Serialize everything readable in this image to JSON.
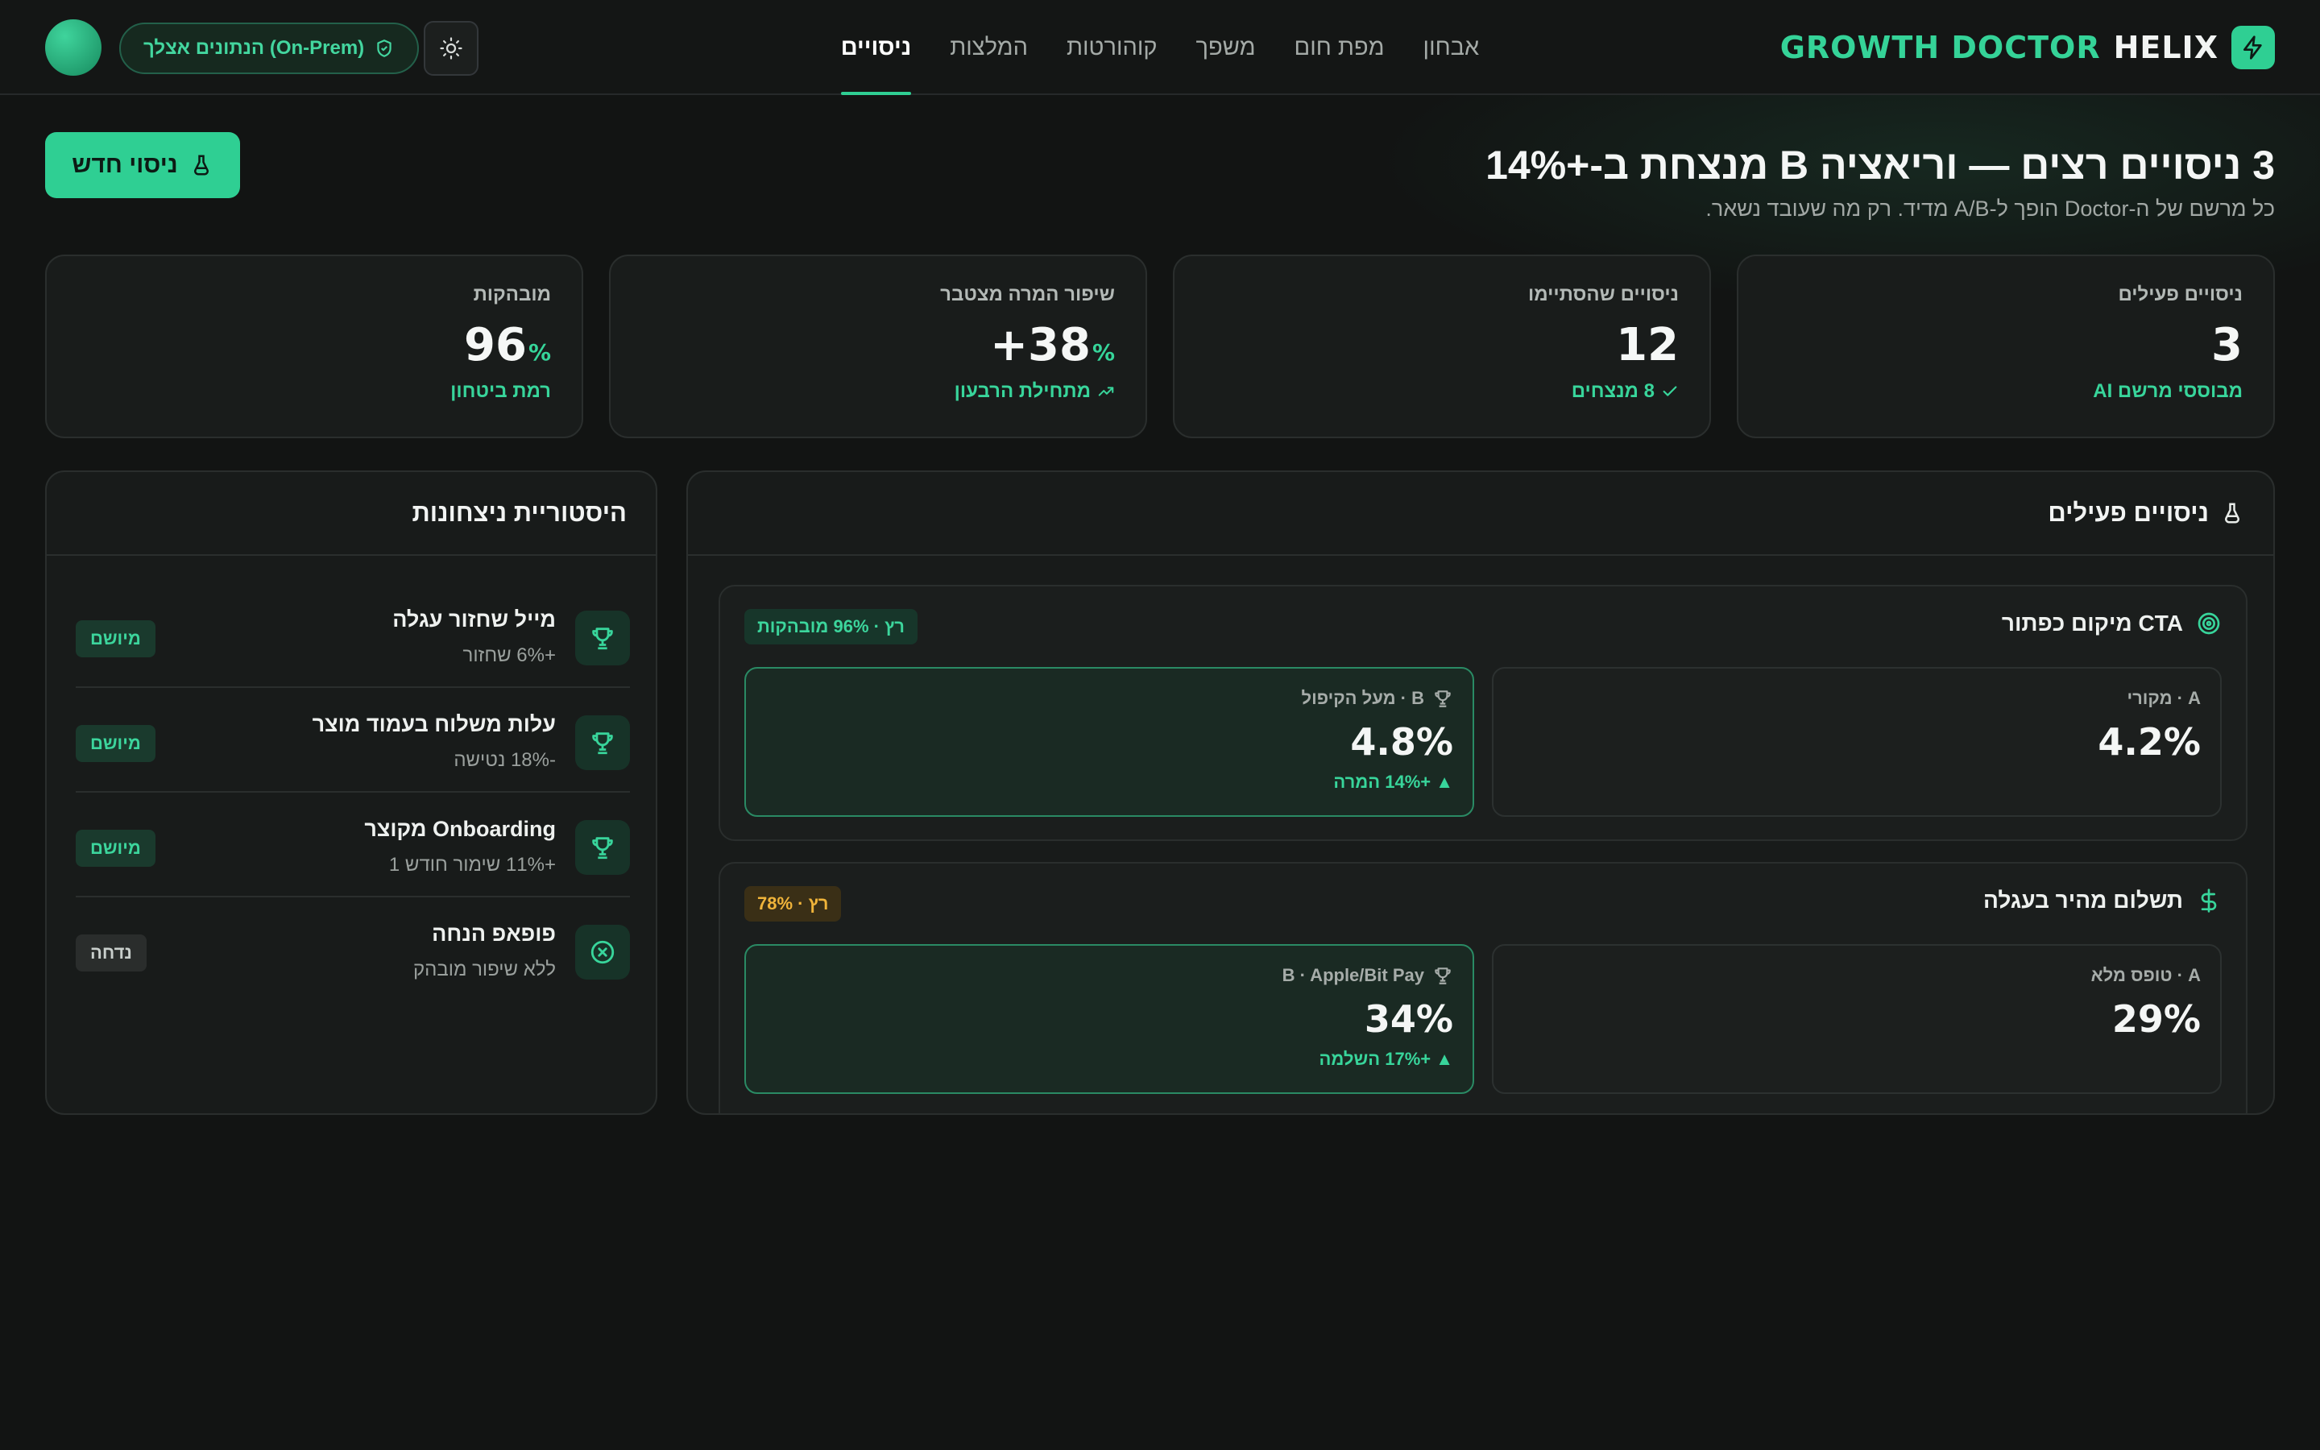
{
  "brand": {
    "name_primary": "HELIX",
    "name_secondary": "GROWTH DOCTOR",
    "icon": "lightning-icon",
    "accent": "#2fcf93"
  },
  "nav": {
    "items": [
      {
        "label": "אבחון",
        "active": false
      },
      {
        "label": "מפת חום",
        "active": false
      },
      {
        "label": "משפך",
        "active": false
      },
      {
        "label": "קוהורטות",
        "active": false
      },
      {
        "label": "המלצות",
        "active": false
      },
      {
        "label": "ניסויים",
        "active": true
      }
    ]
  },
  "header_controls": {
    "onprem_label": "הנתונים אצלך (On-Prem)",
    "onprem_icon": "shield-check-icon",
    "theme_icon": "sun-icon"
  },
  "page": {
    "title": "3 ניסויים רצים — וריאציה B מנצחת ב-+14%",
    "subtitle": "כל מרשם של ה-Doctor הופך ל-A/B מדיד. רק מה שעובד נשאר.",
    "new_button_label": "ניסוי חדש",
    "new_button_icon": "flask-icon"
  },
  "kpis": [
    {
      "label": "ניסויים פעילים",
      "value": "3",
      "unit": "",
      "foot": "מבוססי מרשם AI",
      "foot_icon": ""
    },
    {
      "label": "ניסויים שהסתיימו",
      "value": "12",
      "unit": "",
      "foot": "8 מנצחים",
      "foot_icon": "check-icon"
    },
    {
      "label": "שיפור המרה מצטבר",
      "value": "+38",
      "unit": "%",
      "foot": "מתחילת הרבעון",
      "foot_icon": "trending-up-icon"
    },
    {
      "label": "מובהקות",
      "value": "96",
      "unit": "%",
      "foot": "רמת ביטחון",
      "foot_icon": ""
    }
  ],
  "experiments_panel": {
    "title": "ניסויים פעילים",
    "icon": "flask-icon",
    "experiments": [
      {
        "title": "מיקום כפתור CTA",
        "icon": "target-icon",
        "status": "רץ · 96% מובהקות",
        "status_tone": "green",
        "variant_a": {
          "label": "A · מקורי",
          "value": "4.2%"
        },
        "variant_b": {
          "label": "B · מעל הקיפול",
          "value": "4.8%",
          "lift": "▲ +14% המרה"
        }
      },
      {
        "title": "תשלום מהיר בעגלה",
        "icon": "dollar-icon",
        "status": "רץ · 78%",
        "status_tone": "amber",
        "variant_a": {
          "label": "A · טופס מלא",
          "value": "29%"
        },
        "variant_b": {
          "label": "B · Apple/Bit Pay",
          "value": "34%",
          "lift": "▲ +17% השלמה"
        }
      }
    ]
  },
  "history_panel": {
    "title": "היסטוריית ניצחונות",
    "items": [
      {
        "title": "מייל שחזור עגלה",
        "sub": "+6% שחזור",
        "badge": "מיושם",
        "result": "won",
        "icon": "trophy-icon"
      },
      {
        "title": "עלות משלוח בעמוד מוצר",
        "sub": "-18% נטישה",
        "badge": "מיושם",
        "result": "won",
        "icon": "trophy-icon"
      },
      {
        "title": "Onboarding מקוצר",
        "sub": "+11% שימור חודש 1",
        "badge": "מיושם",
        "result": "won",
        "icon": "trophy-icon"
      },
      {
        "title": "פופאפ הנחה",
        "sub": "ללא שיפור מובהק",
        "badge": "נדחה",
        "result": "rejected",
        "icon": "x-circle-icon"
      }
    ]
  },
  "colors": {
    "background": "#121413",
    "accent": "#2fcf93",
    "amber": "#f0b43a"
  }
}
